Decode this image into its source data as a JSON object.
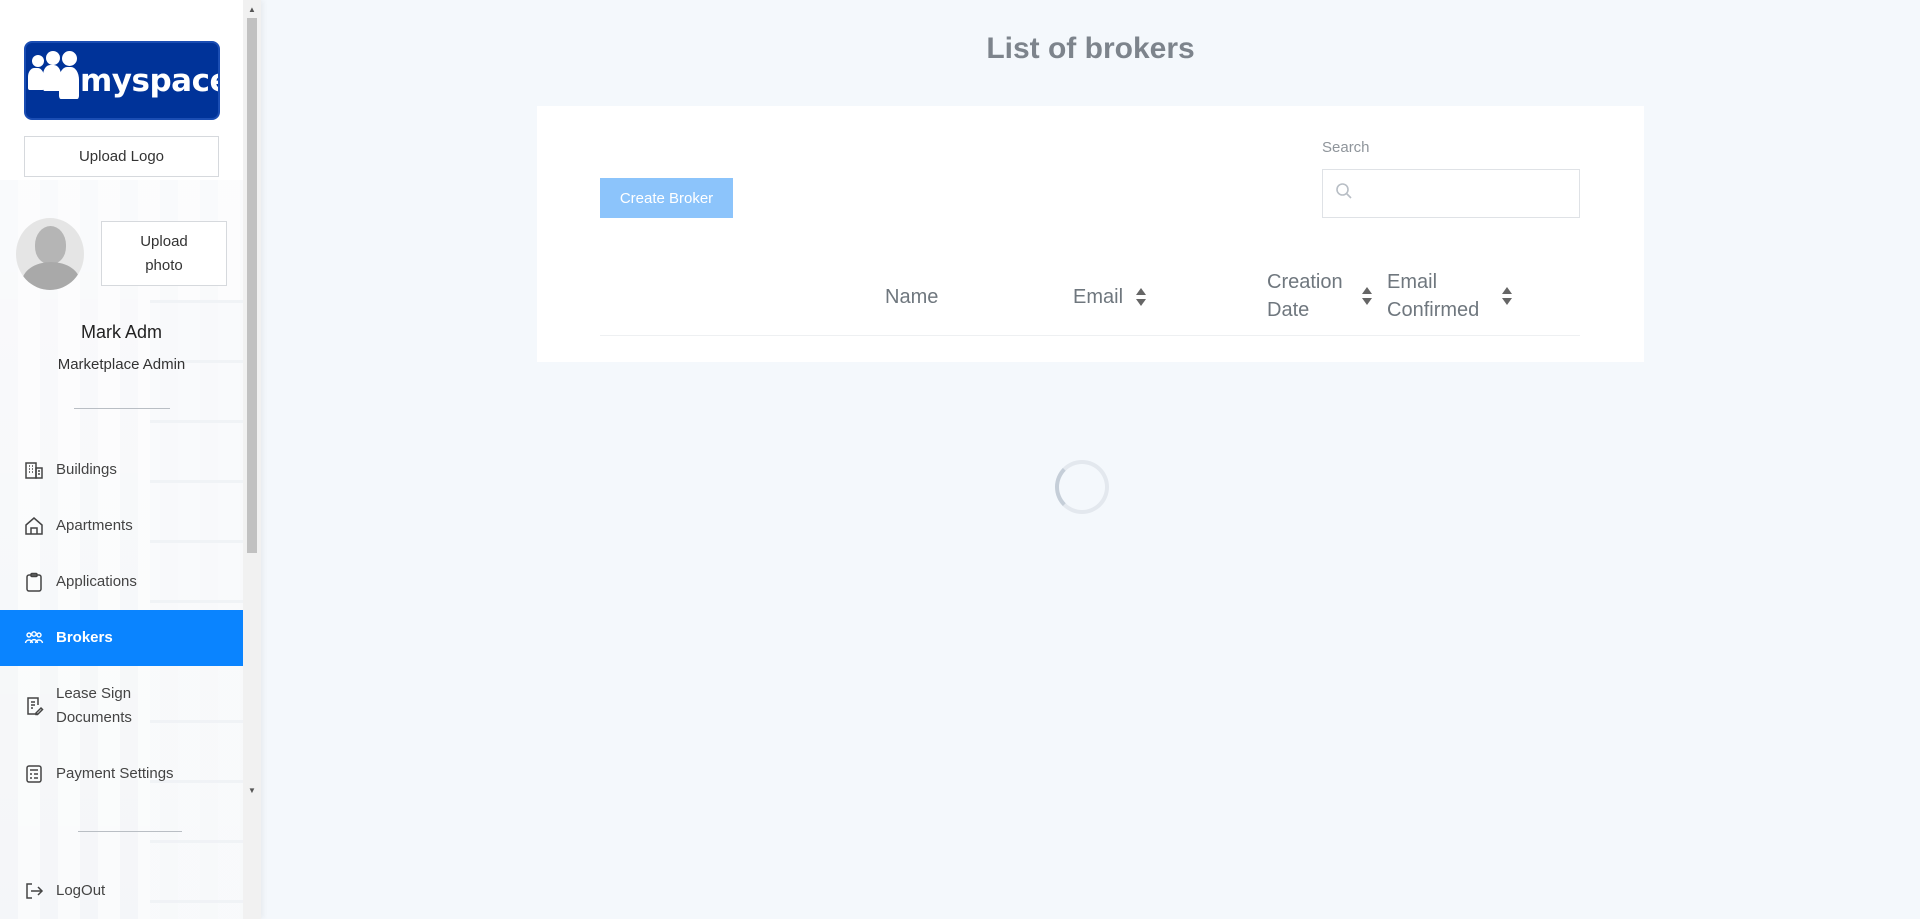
{
  "sidebar": {
    "logo_text": "myspace",
    "upload_logo_label": "Upload Logo",
    "upload_photo_label": "Upload photo",
    "user": {
      "name": "Mark Adm",
      "role": "Marketplace Admin"
    },
    "nav": [
      {
        "label": "Buildings",
        "icon": "building-icon",
        "active": false
      },
      {
        "label": "Apartments",
        "icon": "home-icon",
        "active": false
      },
      {
        "label": "Applications",
        "icon": "clipboard-icon",
        "active": false
      },
      {
        "label": "Brokers",
        "icon": "people-icon",
        "active": true
      },
      {
        "label": "Lease Sign Documents",
        "icon": "document-edit-icon",
        "active": false
      },
      {
        "label": "Payment Settings",
        "icon": "calculator-icon",
        "active": false
      }
    ],
    "logout_label": "LogOut"
  },
  "main": {
    "title": "List of brokers",
    "create_button_label": "Create Broker",
    "search": {
      "label": "Search",
      "placeholder": "",
      "value": ""
    },
    "table": {
      "columns": [
        {
          "label": "Name",
          "sortable": false
        },
        {
          "label": "Email",
          "sortable": true
        },
        {
          "label": "Creation Date",
          "sortable": true
        },
        {
          "label": "Email Confirmed",
          "sortable": true
        }
      ],
      "rows": []
    },
    "loading": true
  },
  "colors": {
    "accent": "#0a84ff",
    "create_button": "#8cc4fb",
    "logo_background": "#003399",
    "background": "#f4f8fc"
  }
}
